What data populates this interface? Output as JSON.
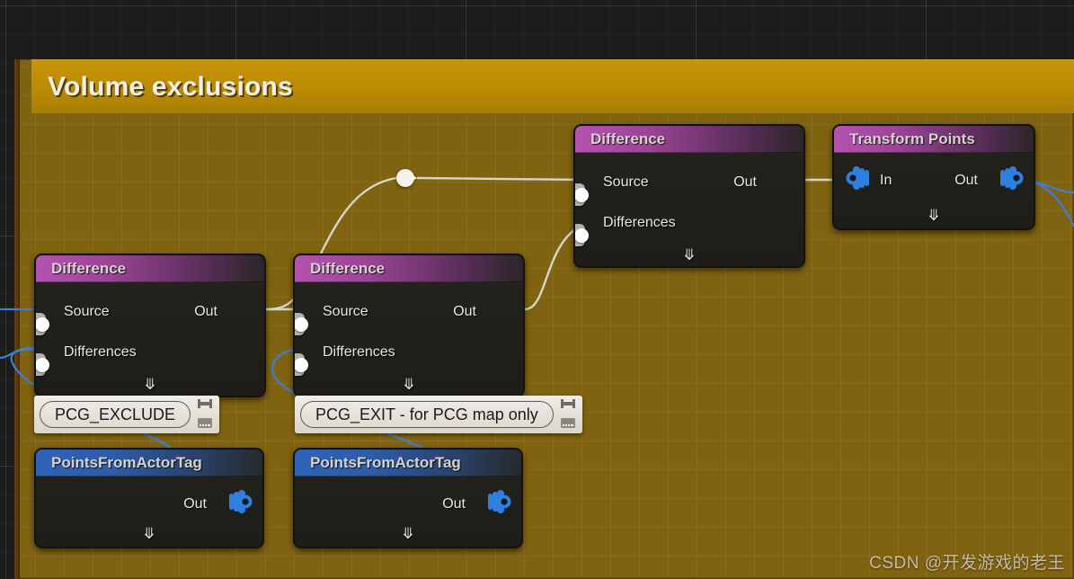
{
  "comment": {
    "title": "Volume exclusions",
    "color": "#bb8b05"
  },
  "nodes": [
    {
      "id": "difference-left",
      "title": "Difference",
      "header_color": "#a6479f",
      "inputs": [
        "Source",
        "Differences"
      ],
      "outputs": [
        "Out"
      ],
      "expand_icon": "chevron-down-icon"
    },
    {
      "id": "difference-middle",
      "title": "Difference",
      "header_color": "#a6479f",
      "inputs": [
        "Source",
        "Differences"
      ],
      "outputs": [
        "Out"
      ],
      "expand_icon": "chevron-down-icon"
    },
    {
      "id": "difference-right",
      "title": "Difference",
      "header_color": "#a6479f",
      "inputs": [
        "Source",
        "Differences"
      ],
      "outputs": [
        "Out"
      ],
      "expand_icon": "chevron-down-icon"
    },
    {
      "id": "transform-points",
      "title": "Transform Points",
      "header_color": "#a6479f",
      "inputs": [
        "In"
      ],
      "outputs": [
        "Out"
      ],
      "expand_icon": "chevron-down-icon"
    },
    {
      "id": "points-from-actor-tag-left",
      "title": "PointsFromActorTag",
      "header_color": "#2d5ca8",
      "inputs": [],
      "outputs": [
        "Out"
      ],
      "expand_icon": "chevron-down-icon"
    },
    {
      "id": "points-from-actor-tag-right",
      "title": "PointsFromActorTag",
      "header_color": "#2d5ca8",
      "inputs": [],
      "outputs": [
        "Out"
      ],
      "expand_icon": "chevron-down-icon"
    }
  ],
  "tags": [
    {
      "id": "tag-pcg-exclude",
      "text": "PCG_EXCLUDE",
      "icons": [
        "pin-icon",
        "keyboard-icon"
      ]
    },
    {
      "id": "tag-pcg-exit",
      "text": "PCG_EXIT - for PCG map only",
      "icons": [
        "pin-icon",
        "keyboard-icon"
      ]
    }
  ],
  "reroute": {
    "name": "reroute-node"
  },
  "watermark": {
    "text": "CSDN @开发游戏的老王"
  }
}
